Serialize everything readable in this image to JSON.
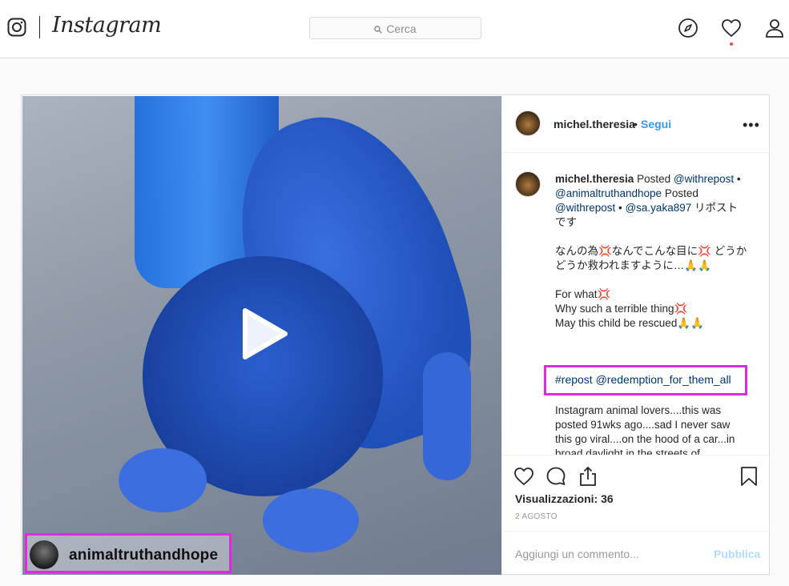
{
  "nav": {
    "wordmark": "Instagram",
    "search_placeholder": "Cerca"
  },
  "post": {
    "username": "michel.theresia",
    "follow_label": "Segui",
    "more_label": "•••",
    "video_tag_username": "animaltruthandhope",
    "caption": {
      "line1_prefix": "Posted",
      "mention1": "@withrepost",
      "mention2": "@animaltruthandhope",
      "line2_word": "Posted",
      "mention3": "@withrepost",
      "mention4": "@sa.yaka897",
      "jp_tail": "リポストです",
      "jp_para": "なんの為💢なんでこんな目に💢 どうかどうか救われますように…🙏🙏",
      "en_1": "For what💢",
      "en_2": "Why such a terrible thing💢",
      "en_3": "May this child be rescued🙏🙏",
      "highlight": "#repost @redemption_for_them_all",
      "body": "Instagram animal lovers....this was posted 91wks ago....sad I never saw this go viral....on the hood of a car...in broad daylight in the streets of"
    },
    "views_label": "Visualizzazioni: 36",
    "date": "2 AGOSTO",
    "comment_placeholder": "Aggiungi un commento...",
    "publish_label": "Pubblica"
  },
  "colors": {
    "link_blue": "#3897f0",
    "mention_blue": "#003569",
    "highlight_magenta": "#e029e0",
    "notification_red": "#ed4956"
  },
  "icons": [
    "instagram-glyph-icon",
    "search-icon",
    "explore-compass-icon",
    "heart-icon",
    "profile-icon",
    "play-icon",
    "like-heart-icon",
    "comment-icon",
    "share-icon",
    "bookmark-icon"
  ]
}
